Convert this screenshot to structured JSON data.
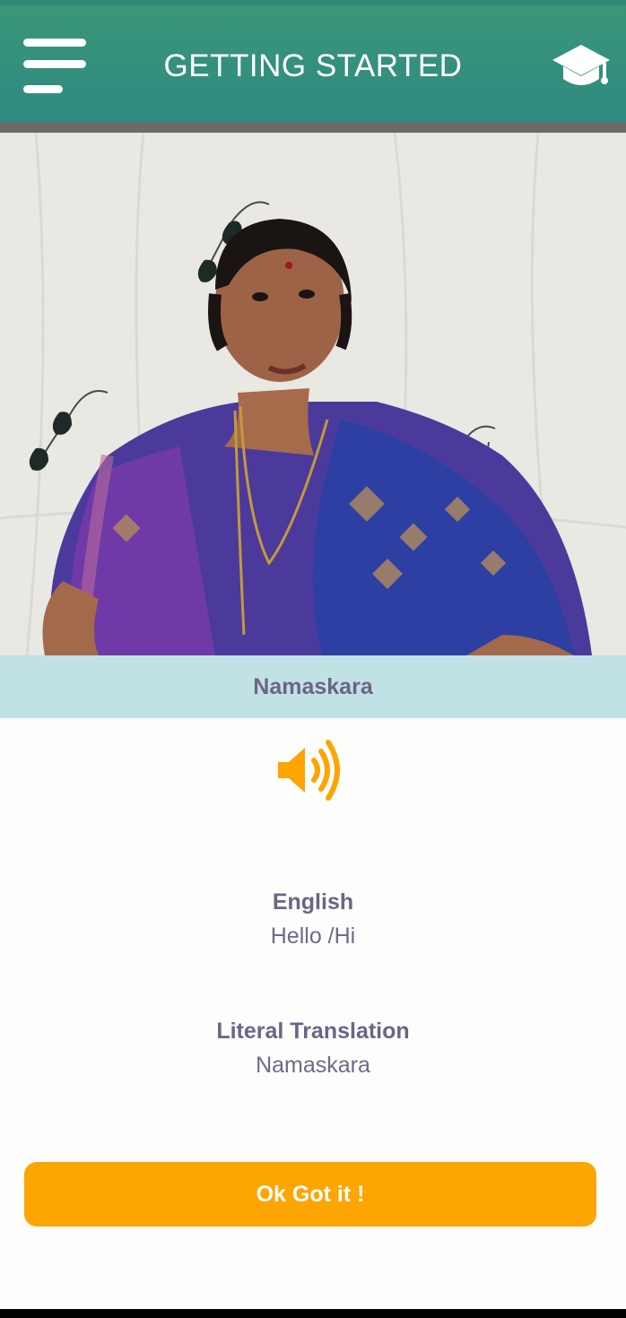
{
  "header": {
    "title": "GETTING STARTED",
    "menu_icon": "hamburger-menu-icon",
    "right_icon": "graduation-cap-icon"
  },
  "lesson": {
    "caption": "Namaskara",
    "audio_icon": "speaker-volume-icon",
    "english_label": "English",
    "english_value": "Hello /Hi",
    "literal_label": "Literal Translation",
    "literal_value": "Namaskara"
  },
  "actions": {
    "ok_label": "Ok Got it !"
  },
  "colors": {
    "header": "#3a9677",
    "caption_bar": "#c1e2e4",
    "accent": "#fca503",
    "text": "#6b6585"
  }
}
